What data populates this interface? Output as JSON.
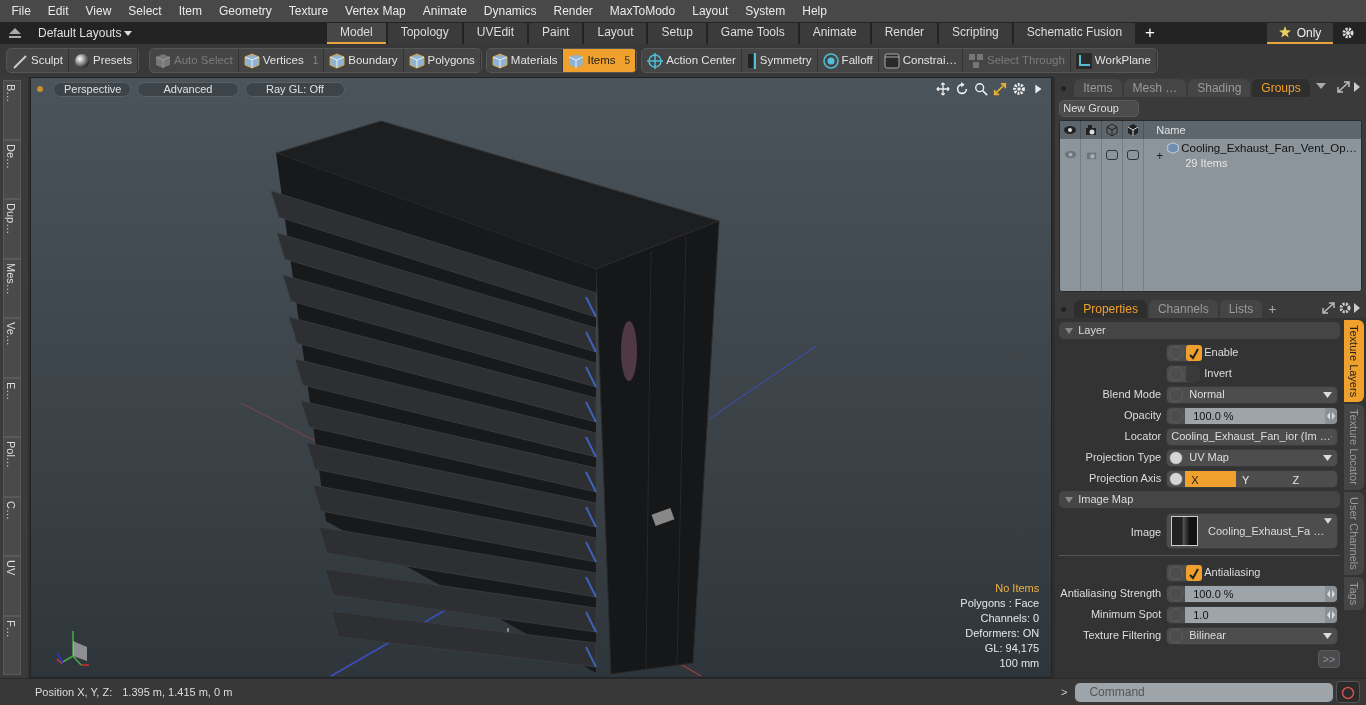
{
  "menu": [
    "File",
    "Edit",
    "View",
    "Select",
    "Item",
    "Geometry",
    "Texture",
    "Vertex Map",
    "Animate",
    "Dynamics",
    "Render",
    "MaxToModo",
    "Layout",
    "System",
    "Help"
  ],
  "layout_bar": {
    "layouts": "Default Layouts",
    "tabs": [
      {
        "label": "Model",
        "selected": true
      },
      {
        "label": "Topology",
        "selected": false
      },
      {
        "label": "UVEdit",
        "selected": false
      },
      {
        "label": "Paint",
        "selected": false
      },
      {
        "label": "Layout",
        "selected": false
      },
      {
        "label": "Setup",
        "selected": false
      },
      {
        "label": "Game Tools",
        "selected": false
      },
      {
        "label": "Animate",
        "selected": false
      },
      {
        "label": "Render",
        "selected": false
      },
      {
        "label": "Scripting",
        "selected": false
      },
      {
        "label": "Schematic Fusion",
        "selected": false
      }
    ],
    "add": "+",
    "only": "Only"
  },
  "toolbar": [
    [
      {
        "label": "Sculpt",
        "selected": false,
        "disabled": false
      },
      {
        "label": "Presets",
        "selected": false,
        "disabled": false
      }
    ],
    [
      {
        "label": "Auto Select",
        "selected": false,
        "disabled": true
      },
      {
        "label": "Vertices",
        "selected": false,
        "disabled": false,
        "count": "1"
      },
      {
        "label": "Boundary",
        "selected": false,
        "disabled": false
      },
      {
        "label": "Polygons",
        "selected": false,
        "disabled": false
      }
    ],
    [
      {
        "label": "Materials",
        "selected": false,
        "disabled": false
      },
      {
        "label": "Items",
        "selected": true,
        "disabled": false,
        "count": "5"
      }
    ],
    [
      {
        "label": "Action Center",
        "selected": false,
        "disabled": false
      },
      {
        "label": "Symmetry",
        "selected": false,
        "disabled": false
      },
      {
        "label": "Falloff",
        "selected": false,
        "disabled": false
      },
      {
        "label": "Constrai…",
        "selected": false,
        "disabled": false
      },
      {
        "label": "Select Through",
        "selected": false,
        "disabled": true
      },
      {
        "label": "WorkPlane",
        "selected": false,
        "disabled": false
      }
    ]
  ],
  "left_tabs": [
    "B…",
    "De…",
    "Dup…",
    "Mes…",
    "Ve…",
    "E…",
    "Pol…",
    "C…",
    "UV",
    "F…"
  ],
  "viewport": {
    "buttons": [
      "Perspective",
      "Advanced",
      "Ray GL: Off"
    ],
    "info": [
      {
        "text": "No Items",
        "highlight": true
      },
      {
        "text": "Polygons : Face",
        "highlight": false
      },
      {
        "text": "Channels: 0",
        "highlight": false
      },
      {
        "text": "Deformers: ON",
        "highlight": false
      },
      {
        "text": "GL: 94,175",
        "highlight": false
      },
      {
        "text": "100 mm",
        "highlight": false
      }
    ]
  },
  "groups_panel": {
    "tabs": [
      {
        "label": "Items",
        "selected": false
      },
      {
        "label": "Mesh …",
        "selected": false
      },
      {
        "label": "Shading",
        "selected": false
      },
      {
        "label": "Groups",
        "selected": true
      }
    ],
    "new_group": "New Group",
    "name_column": "Name",
    "rows": [
      {
        "expander": "+",
        "name": "Cooling_Exhaust_Fan_Vent_Op…",
        "count": "29 Items"
      }
    ]
  },
  "properties": {
    "tabs": [
      {
        "label": "Properties",
        "selected": true
      },
      {
        "label": "Channels",
        "selected": false
      },
      {
        "label": "Lists",
        "selected": false
      }
    ],
    "add": "+",
    "sections": [
      {
        "title": "Layer",
        "rows": [
          {
            "kind": "check",
            "label": "Enable",
            "checked": true
          },
          {
            "kind": "check",
            "label": "Invert",
            "checked": false
          },
          {
            "kind": "dropdown",
            "label": "Blend Mode",
            "value": "Normal",
            "keyed": false
          },
          {
            "kind": "number",
            "label": "Opacity",
            "value": "100.0 %",
            "keyed": false
          },
          {
            "kind": "dropdown",
            "label": "Locator",
            "value": "Cooling_Exhaust_Fan_ior (Im …"
          },
          {
            "kind": "dropdown",
            "label": "Projection Type",
            "value": "UV Map",
            "keyed": true
          },
          {
            "kind": "axis",
            "label": "Projection Axis",
            "keyed": true,
            "options": [
              {
                "label": "X",
                "selected": true
              },
              {
                "label": "Y",
                "selected": false
              },
              {
                "label": "Z",
                "selected": false
              }
            ]
          }
        ]
      },
      {
        "title": "Image Map",
        "rows": [
          {
            "kind": "image",
            "label": "Image",
            "value": "Cooling_Exhaust_Fa …"
          },
          {
            "kind": "separator"
          },
          {
            "kind": "check",
            "label": "Antialiasing",
            "checked": true
          },
          {
            "kind": "number",
            "label": "Antialiasing Strength",
            "value": "100.0 %",
            "keyed": false
          },
          {
            "kind": "number",
            "label": "Minimum Spot",
            "value": "1.0",
            "keyed": false
          },
          {
            "kind": "dropdown",
            "label": "Texture Filtering",
            "value": "Bilinear",
            "keyed": false
          }
        ]
      }
    ],
    "more": ">>",
    "side_tabs": [
      {
        "label": "Texture Layers",
        "selected": true
      },
      {
        "label": "Texture Locator",
        "selected": false
      },
      {
        "label": "User Channels",
        "selected": false
      },
      {
        "label": "Tags",
        "selected": false
      }
    ]
  },
  "status_bar": {
    "position_label": "Position X, Y, Z:",
    "position_value": "1.395 m, 1.415 m, 0 m"
  },
  "command": {
    "prompt": ">",
    "placeholder": "Command"
  }
}
